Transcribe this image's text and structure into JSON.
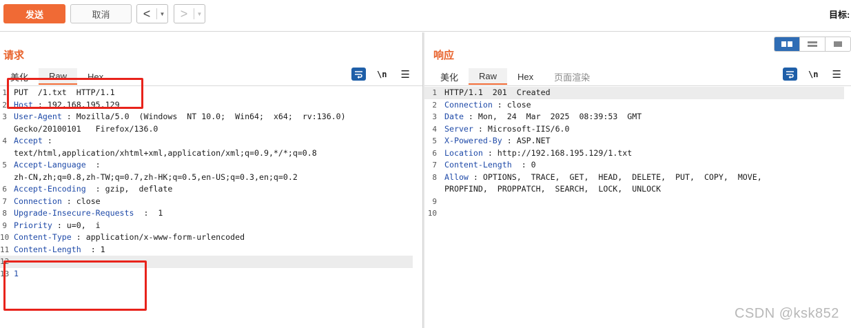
{
  "toolbar": {
    "send_label": "发送",
    "cancel_label": "取消",
    "back_arrow": "<",
    "forward_arrow": ">",
    "dropdown_glyph": "▼",
    "target_label": "目标:"
  },
  "request": {
    "title": "请求",
    "tabs": [
      {
        "label": "美化",
        "active": false
      },
      {
        "label": "Raw",
        "active": true
      },
      {
        "label": "Hex",
        "active": false
      }
    ],
    "newline_tool": "\\n",
    "lines": [
      {
        "num": "1",
        "key": "",
        "sep": "",
        "value": "PUT  /1.txt  HTTP/1.1",
        "highlight": false
      },
      {
        "num": "2",
        "key": "Host",
        "sep": " : ",
        "value": "192.168.195.129",
        "highlight": false
      },
      {
        "num": "3",
        "key": "User-Agent",
        "sep": " : ",
        "value": "Mozilla/5.0  (Windows  NT 10.0;  Win64;  x64;  rv:136.0)",
        "highlight": false
      },
      {
        "num": "",
        "key": "",
        "sep": "",
        "value": "Gecko/20100101   Firefox/136.0",
        "highlight": false
      },
      {
        "num": "4",
        "key": "Accept",
        "sep": " : ",
        "value": "",
        "highlight": false
      },
      {
        "num": "",
        "key": "",
        "sep": "",
        "value": "text/html,application/xhtml+xml,application/xml;q=0.9,*/*;q=0.8",
        "highlight": false
      },
      {
        "num": "5",
        "key": "Accept-Language",
        "sep": "  : ",
        "value": "",
        "highlight": false
      },
      {
        "num": "",
        "key": "",
        "sep": "",
        "value": "zh-CN,zh;q=0.8,zh-TW;q=0.7,zh-HK;q=0.5,en-US;q=0.3,en;q=0.2",
        "highlight": false
      },
      {
        "num": "6",
        "key": "Accept-Encoding",
        "sep": "  : ",
        "value": "gzip,  deflate",
        "highlight": false
      },
      {
        "num": "7",
        "key": "Connection",
        "sep": " : ",
        "value": "close",
        "highlight": false
      },
      {
        "num": "8",
        "key": "Upgrade-Insecure-Requests",
        "sep": "  :  ",
        "value": "1",
        "highlight": false
      },
      {
        "num": "9",
        "key": "Priority",
        "sep": " : ",
        "value": "u=0,  i",
        "highlight": false
      },
      {
        "num": "10",
        "key": "Content-Type",
        "sep": " : ",
        "value": "application/x-www-form-urlencoded",
        "highlight": false
      },
      {
        "num": "11",
        "key": "Content-Length",
        "sep": "  : ",
        "value": "1",
        "highlight": false
      },
      {
        "num": "12",
        "key": "",
        "sep": "",
        "value": "",
        "highlight": true
      },
      {
        "num": "13",
        "key": "",
        "sep": "",
        "value": "1",
        "highlight": false,
        "body": true
      }
    ]
  },
  "response": {
    "title": "响应",
    "tabs": [
      {
        "label": "美化",
        "active": false
      },
      {
        "label": "Raw",
        "active": true
      },
      {
        "label": "Hex",
        "active": false
      },
      {
        "label": "页面渲染",
        "active": false,
        "muted": true
      }
    ],
    "newline_tool": "\\n",
    "lines": [
      {
        "num": "1",
        "key": "",
        "sep": "",
        "value": "HTTP/1.1  201  Created",
        "highlight": true
      },
      {
        "num": "2",
        "key": "Connection",
        "sep": " : ",
        "value": "close",
        "highlight": false
      },
      {
        "num": "3",
        "key": "Date",
        "sep": " : ",
        "value": "Mon,  24  Mar  2025  08:39:53  GMT",
        "highlight": false
      },
      {
        "num": "4",
        "key": "Server",
        "sep": " : ",
        "value": "Microsoft-IIS/6.0",
        "highlight": false
      },
      {
        "num": "5",
        "key": "X-Powered-By",
        "sep": " : ",
        "value": "ASP.NET",
        "highlight": false
      },
      {
        "num": "6",
        "key": "Location",
        "sep": " : ",
        "value": "http://192.168.195.129/1.txt",
        "highlight": false
      },
      {
        "num": "7",
        "key": "Content-Length",
        "sep": "  : ",
        "value": "0",
        "highlight": false
      },
      {
        "num": "8",
        "key": "Allow",
        "sep": " : ",
        "value": "OPTIONS,  TRACE,  GET,  HEAD,  DELETE,  PUT,  COPY,  MOVE,",
        "highlight": false
      },
      {
        "num": "",
        "key": "",
        "sep": "",
        "value": "PROPFIND,  PROPPATCH,  SEARCH,  LOCK,  UNLOCK",
        "highlight": false
      },
      {
        "num": "9",
        "key": "",
        "sep": "",
        "value": "",
        "highlight": false
      },
      {
        "num": "10",
        "key": "",
        "sep": "",
        "value": "",
        "highlight": false
      }
    ]
  },
  "watermark": "CSDN @ksk852",
  "colors": {
    "accent": "#f06a35",
    "header_key": "#1f4aa8",
    "annotation_red": "#e8231b",
    "toggle_active": "#2f6db5"
  }
}
